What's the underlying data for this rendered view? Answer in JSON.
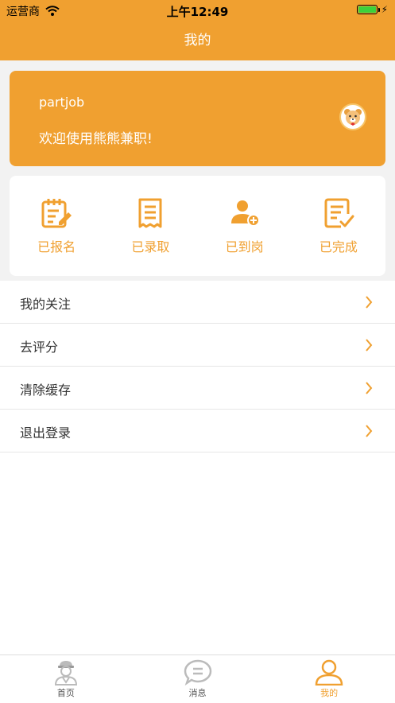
{
  "status_bar": {
    "carrier": "运营商",
    "time": "上午12:49"
  },
  "nav": {
    "title": "我的"
  },
  "profile": {
    "username": "partjob",
    "welcome": "欢迎使用熊熊兼职!"
  },
  "status_items": [
    {
      "label": "已报名",
      "icon": "clipboard-edit-icon"
    },
    {
      "label": "已录取",
      "icon": "receipt-icon"
    },
    {
      "label": "已到岗",
      "icon": "person-add-icon"
    },
    {
      "label": "已完成",
      "icon": "checklist-icon"
    }
  ],
  "menu": [
    {
      "label": "我的关注"
    },
    {
      "label": "去评分"
    },
    {
      "label": "清除缓存"
    },
    {
      "label": "退出登录"
    }
  ],
  "tabs": [
    {
      "label": "首页",
      "icon": "worker-icon"
    },
    {
      "label": "消息",
      "icon": "chat-icon"
    },
    {
      "label": "我的",
      "icon": "user-icon"
    }
  ],
  "colors": {
    "accent": "#f0a030",
    "background": "#f2f2f2"
  }
}
